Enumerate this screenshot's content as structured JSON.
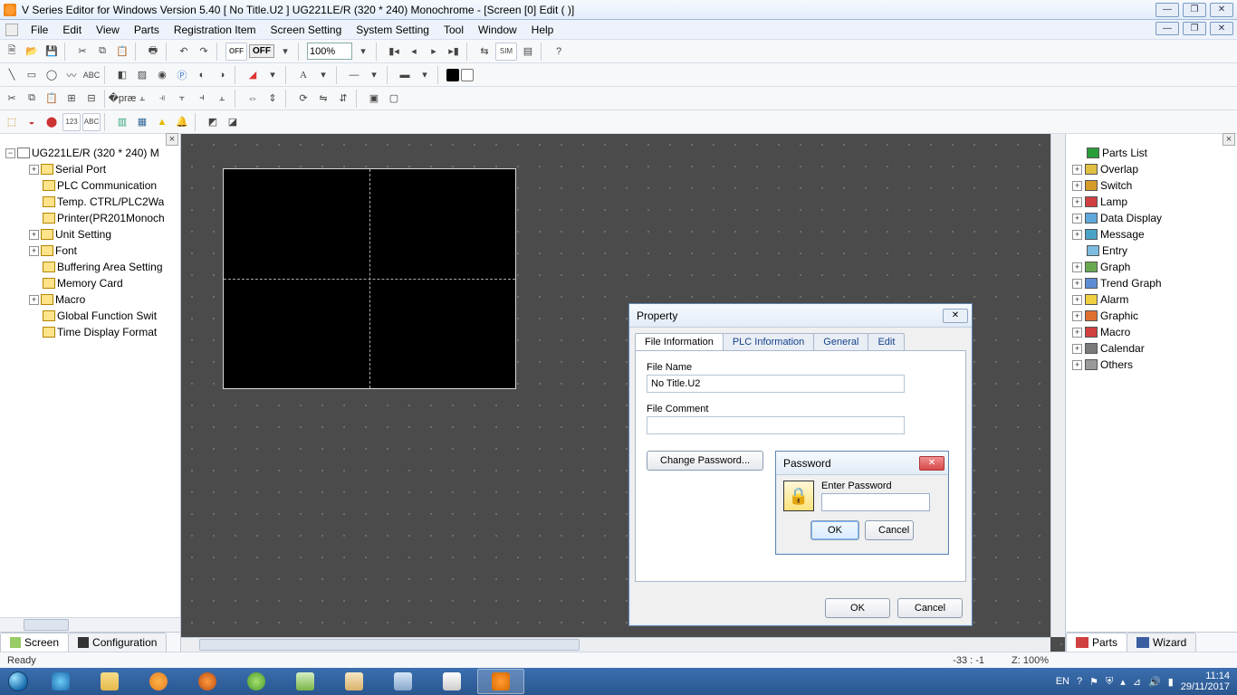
{
  "title": "V Series Editor for Windows Version 5.40 [ No Title.U2 ] UG221LE/R (320 * 240) Monochrome - [Screen [0] Edit (              )]",
  "menu": [
    "File",
    "Edit",
    "View",
    "Parts",
    "Registration Item",
    "Screen Setting",
    "System Setting",
    "Tool",
    "Window",
    "Help"
  ],
  "zoom": "100%",
  "off_toggle": "OFF",
  "tree_root": "UG221LE/R (320 * 240) M",
  "tree": [
    {
      "label": "Serial Port",
      "exp": "+"
    },
    {
      "label": "PLC Communication"
    },
    {
      "label": "Temp. CTRL/PLC2Wa"
    },
    {
      "label": "Printer(PR201Monoch"
    },
    {
      "label": "Unit Setting",
      "exp": "+"
    },
    {
      "label": "Font",
      "exp": "+"
    },
    {
      "label": "Buffering Area Setting"
    },
    {
      "label": "Memory Card"
    },
    {
      "label": "Macro",
      "exp": "+"
    },
    {
      "label": "Global Function Swit"
    },
    {
      "label": "Time Display Format"
    }
  ],
  "left_tabs": {
    "screen": "Screen",
    "config": "Configuration"
  },
  "parts": [
    {
      "label": "Parts List",
      "color": "#2a9d3a"
    },
    {
      "label": "Overlap",
      "color": "#e0c040",
      "exp": "+"
    },
    {
      "label": "Switch",
      "color": "#d69d2b",
      "exp": "+"
    },
    {
      "label": "Lamp",
      "color": "#d14040",
      "exp": "+"
    },
    {
      "label": "Data Display",
      "color": "#5fa8dd",
      "exp": "+"
    },
    {
      "label": "Message",
      "color": "#4aa3c7",
      "exp": "+"
    },
    {
      "label": "Entry",
      "color": "#7dbce0"
    },
    {
      "label": "Graph",
      "color": "#6aa84f",
      "exp": "+"
    },
    {
      "label": "Trend Graph",
      "color": "#5f8dd3",
      "exp": "+"
    },
    {
      "label": "Alarm",
      "color": "#f0d040",
      "exp": "+"
    },
    {
      "label": "Graphic",
      "color": "#e07030",
      "exp": "+"
    },
    {
      "label": "Macro",
      "color": "#d14040",
      "exp": "+"
    },
    {
      "label": "Calendar",
      "color": "#7a7a7a",
      "exp": "+"
    },
    {
      "label": "Others",
      "color": "#999",
      "exp": "+"
    }
  ],
  "right_tabs": {
    "parts": "Parts",
    "wizard": "Wizard"
  },
  "status": {
    "ready": "Ready",
    "coord": "-33 : -1",
    "zoom": "Z: 100%"
  },
  "property": {
    "title": "Property",
    "tabs": [
      "File Information",
      "PLC Information",
      "General",
      "Edit"
    ],
    "file_name_label": "File Name",
    "file_name_value": "No Title.U2",
    "file_comment_label": "File Comment",
    "file_comment_value": "",
    "change_pw": "Change Password...",
    "ok": "OK",
    "cancel": "Cancel"
  },
  "password": {
    "title": "Password",
    "label": "Enter Password",
    "value": "",
    "ok": "OK",
    "cancel": "Cancel"
  },
  "tray": {
    "lang": "EN",
    "time": "11:14",
    "date": "29/11/2017"
  }
}
